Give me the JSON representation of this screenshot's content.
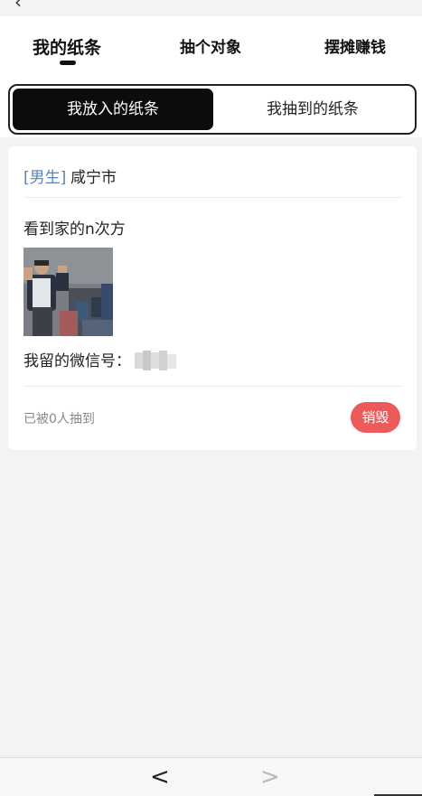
{
  "header": {
    "title": "",
    "back_icon": "chevron-left-icon"
  },
  "tabs": [
    {
      "label": "我的纸条",
      "active": true
    },
    {
      "label": "抽个对象",
      "active": false
    },
    {
      "label": "摆摊赚钱",
      "active": false
    }
  ],
  "segmented": {
    "active_label": "我放入的纸条",
    "inactive_label": "我抽到的纸条"
  },
  "card": {
    "gender": "[男生]",
    "city": "咸宁市",
    "message": "看到家的n次方",
    "wechat_label": "我留的微信号：",
    "wechat_value_state": "blurred",
    "drawn_count_text": "已被0人抽到",
    "destroy_label": "销毁"
  },
  "bottom_nav": {
    "back_icon": "chevron-left-icon",
    "forward_icon": "chevron-right-icon"
  },
  "colors": {
    "accent_blue": "#5a84b4",
    "destroy_red": "#ea5b5a",
    "active_segment": "#0c0c0c",
    "background": "#f3f3f3"
  }
}
